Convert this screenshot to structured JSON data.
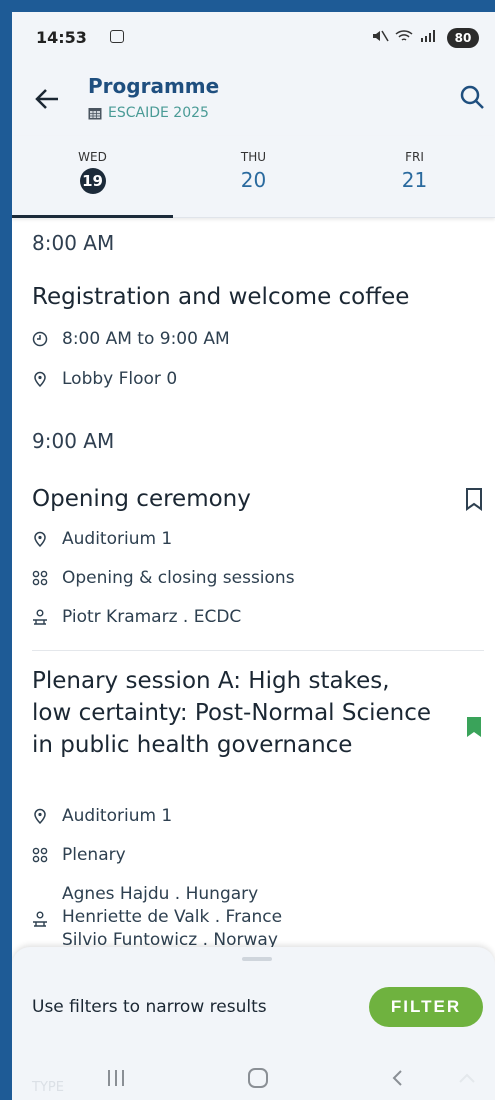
{
  "status": {
    "time": "14:53",
    "battery": "80"
  },
  "appbar": {
    "title": "Programme",
    "subtitle": "ESCAIDE 2025"
  },
  "tabs": [
    {
      "dow": "WED",
      "day": "19",
      "active": true
    },
    {
      "dow": "THU",
      "day": "20",
      "active": false
    },
    {
      "dow": "FRI",
      "day": "21",
      "active": false
    }
  ],
  "schedule": {
    "slots": [
      {
        "time": "8:00 AM",
        "events": [
          {
            "title": "Registration and welcome coffee",
            "time_range": "8:00 AM to 9:00 AM",
            "location": "Lobby Floor 0"
          }
        ]
      },
      {
        "time": "9:00 AM",
        "events": [
          {
            "title": "Opening ceremony",
            "location": "Auditorium 1",
            "track": "Opening & closing sessions",
            "speakers": "Piotr Kramarz . ECDC",
            "bookmarked": false
          },
          {
            "title": "Plenary session A: High stakes, low certainty: Post-Normal Science in public health governance",
            "location": "Auditorium 1",
            "track": "Plenary",
            "speakers": [
              "Agnes Hajdu . Hungary",
              "Henriette de Valk . France",
              "Silvio Funtowicz . Norway"
            ],
            "bookmarked": true
          }
        ]
      }
    ]
  },
  "filter": {
    "hint": "Use filters to narrow results",
    "button": "FILTER",
    "ghost_label": "TYPE"
  },
  "colors": {
    "accent": "#1f4f7f",
    "teal": "#4a9b96",
    "filter_green": "#6fb23f",
    "bookmark_green": "#3aa35a",
    "frame_blue": "#1e5b96"
  },
  "icons": [
    "back-arrow-icon",
    "search-icon",
    "calendar-icon",
    "clock-icon",
    "location-pin-icon",
    "category-grid-icon",
    "speaker-icon",
    "bookmark-outline-icon",
    "bookmark-filled-icon"
  ]
}
